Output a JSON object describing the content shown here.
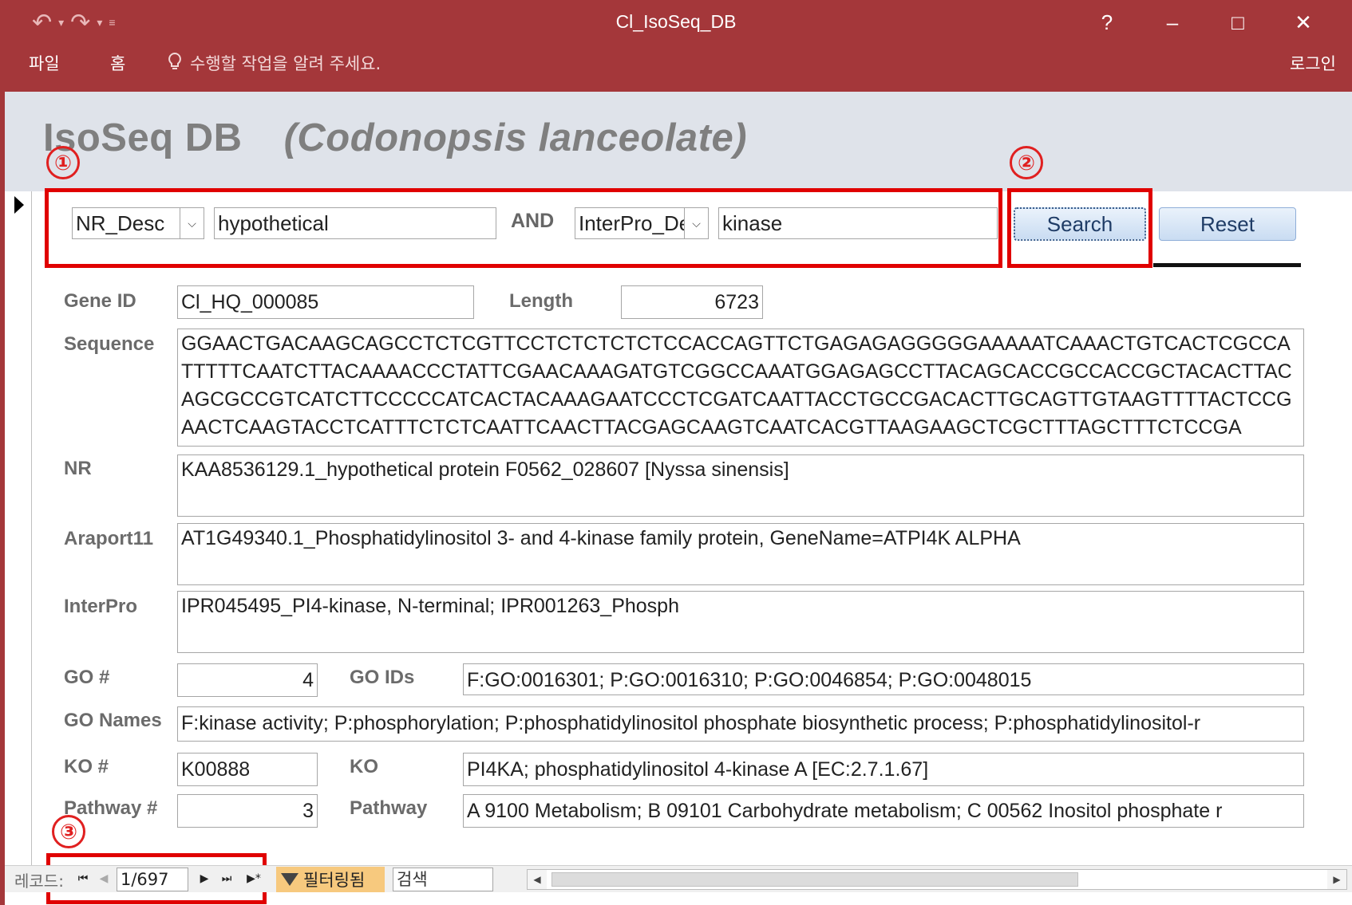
{
  "window": {
    "title": "Cl_IsoSeq_DB",
    "undo_icon": "↶",
    "redo_icon": "↷",
    "help": "?",
    "minimize": "–",
    "maximize": "□",
    "close": "✕"
  },
  "ribbon": {
    "file_tab": "파일",
    "home_tab": "홈",
    "tell_me": "수행할 작업을 알려 주세요.",
    "sign_in": "로그인"
  },
  "form": {
    "title": "IsoSeq DB",
    "species": "(Codonopsis lanceolate)"
  },
  "callouts": [
    "①",
    "②",
    "③"
  ],
  "search": {
    "field1": "NR_Desc",
    "term1": "hypothetical",
    "operator": "AND",
    "field2": "InterPro_De",
    "term2": "kinase",
    "search_button": "Search",
    "reset_button": "Reset"
  },
  "record": {
    "gene_id_label": "Gene ID",
    "gene_id": "Cl_HQ_000085",
    "length_label": "Length",
    "length": "6723",
    "sequence_label": "Sequence",
    "sequence": "GGAACTGACAAGCAGCCTCTCGTTCCTCTCTCTCTCCACCAGTTCTGAGAGAGGGGGAAAAATCAAACTGTCACTCGCCATTTTTCAATCTTACAAAACCCTATTCGAACAAAGATGTCGGCCAAATGGAGAGCCTTACAGCACCGCCACCGCTACACTTACAGCGCCGTCATCTTCCCCCATCACTACAAAGAATCCCTCGATCAATTACCTGCCGACACTTGCAGTTGTAAGTTTTACTCCGAACTCAAGTACCTCATTTCTCTCAATTCAACTTACGAGCAAGTCAATCACGTTAAGAAGCTCGCTTTAGCTTTCTCCGA",
    "nr_label": "NR",
    "nr": "KAA8536129.1_hypothetical protein F0562_028607 [Nyssa sinensis]",
    "araport_label": "Araport11",
    "araport": "AT1G49340.1_Phosphatidylinositol 3- and 4-kinase family protein, GeneName=ATPI4K ALPHA",
    "interpro_label": "InterPro",
    "interpro": "IPR045495_PI4-kinase, N-terminal; IPR001263_Phosph",
    "go_count_label": "GO #",
    "go_count": "4",
    "go_ids_label": "GO IDs",
    "go_ids": "F:GO:0016301; P:GO:0016310; P:GO:0046854; P:GO:0048015",
    "go_names_label": "GO Names",
    "go_names": "F:kinase activity; P:phosphorylation; P:phosphatidylinositol phosphate biosynthetic process; P:phosphatidylinositol-r",
    "ko_count_label": "KO #",
    "ko_count": "K00888",
    "ko_label": "KO",
    "ko": "PI4KA; phosphatidylinositol 4-kinase A [EC:2.7.1.67]",
    "pathway_count_label": "Pathway #",
    "pathway_count": "3",
    "pathway_label": "Pathway",
    "pathway": "A 9100 Metabolism; B 09101 Carbohydrate metabolism; C 00562 Inositol phosphate r"
  },
  "navigation": {
    "record_label": "레코드:",
    "first": "⏮",
    "prev": "◀",
    "position": "1/697",
    "next": "▶",
    "last": "⏭",
    "new": "▶*",
    "filtered": "필터링됨",
    "search": "검색"
  },
  "colors": {
    "titlebar": "#a4373a",
    "highlight": "#e00000",
    "header_band": "#dfe3ea"
  }
}
